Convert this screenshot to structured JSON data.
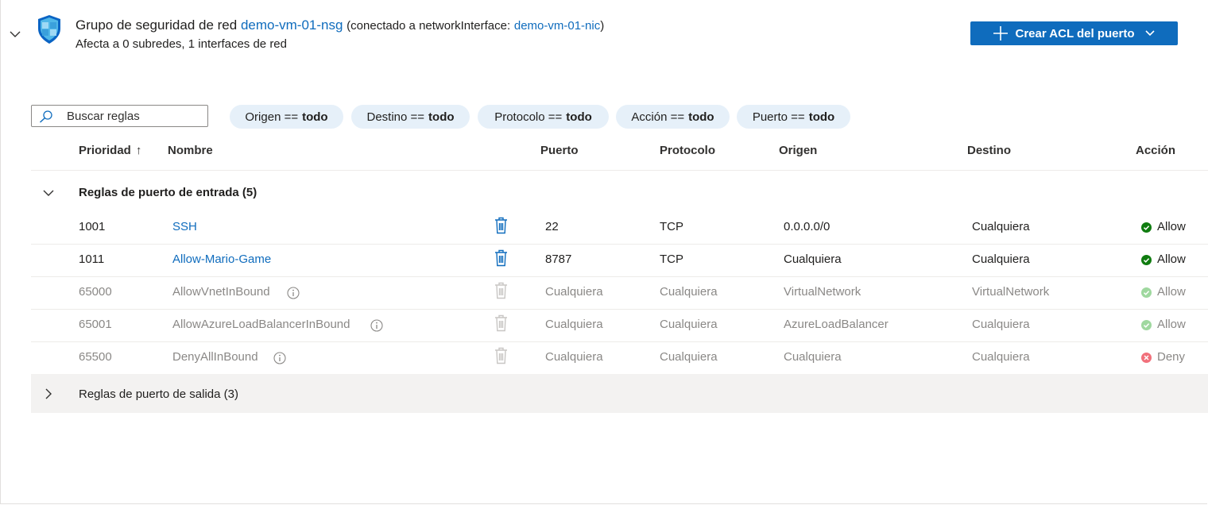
{
  "header": {
    "title_prefix": "Grupo de seguridad de red",
    "nsg_name": "demo-vm-01-nsg",
    "connected_prefix": "(conectado a networkInterface:",
    "nic_name": "demo-vm-01-nic",
    "connected_suffix": ")",
    "subtitle": "Afecta a 0 subredes, 1 interfaces de red",
    "create_button_label": "Crear ACL del puerto"
  },
  "search": {
    "placeholder": "Buscar reglas",
    "value": ""
  },
  "filters": [
    {
      "label": "Origen ==",
      "value": "todo"
    },
    {
      "label": "Destino ==",
      "value": "todo"
    },
    {
      "label": "Protocolo ==",
      "value": "todo"
    },
    {
      "label": "Acción ==",
      "value": "todo"
    },
    {
      "label": "Puerto ==",
      "value": "todo"
    }
  ],
  "columns": {
    "priority": "Prioridad",
    "sort_indicator": "↑",
    "name": "Nombre",
    "port": "Puerto",
    "protocol": "Protocolo",
    "source": "Origen",
    "destination": "Destino",
    "action": "Acción"
  },
  "inbound_group": {
    "label": "Reglas de puerto de entrada (5)"
  },
  "outbound_group": {
    "label": "Reglas de puerto de salida (3)"
  },
  "rules": [
    {
      "priority": "1001",
      "name": "SSH",
      "port": "22",
      "protocol": "TCP",
      "source": "0.0.0.0/0",
      "destination": "Cualquiera",
      "action": "Allow"
    },
    {
      "priority": "1011",
      "name": "Allow-Mario-Game",
      "port": "8787",
      "protocol": "TCP",
      "source": "Cualquiera",
      "destination": "Cualquiera",
      "action": "Allow"
    },
    {
      "priority": "65000",
      "name": "AllowVnetInBound",
      "port": "Cualquiera",
      "protocol": "Cualquiera",
      "source": "VirtualNetwork",
      "destination": "VirtualNetwork",
      "action": "Allow"
    },
    {
      "priority": "65001",
      "name": "AllowAzureLoadBalancerInBound",
      "port": "Cualquiera",
      "protocol": "Cualquiera",
      "source": "AzureLoadBalancer",
      "destination": "Cualquiera",
      "action": "Allow"
    },
    {
      "priority": "65500",
      "name": "DenyAllInBound",
      "port": "Cualquiera",
      "protocol": "Cualquiera",
      "source": "Cualquiera",
      "destination": "Cualquiera",
      "action": "Deny"
    }
  ],
  "colors": {
    "accent": "#0f6cbd",
    "allow": "#107c10",
    "allow_dim": "#9fd89f",
    "deny_dim": "#f1707b",
    "filter_pill": "#e6f0f9"
  }
}
